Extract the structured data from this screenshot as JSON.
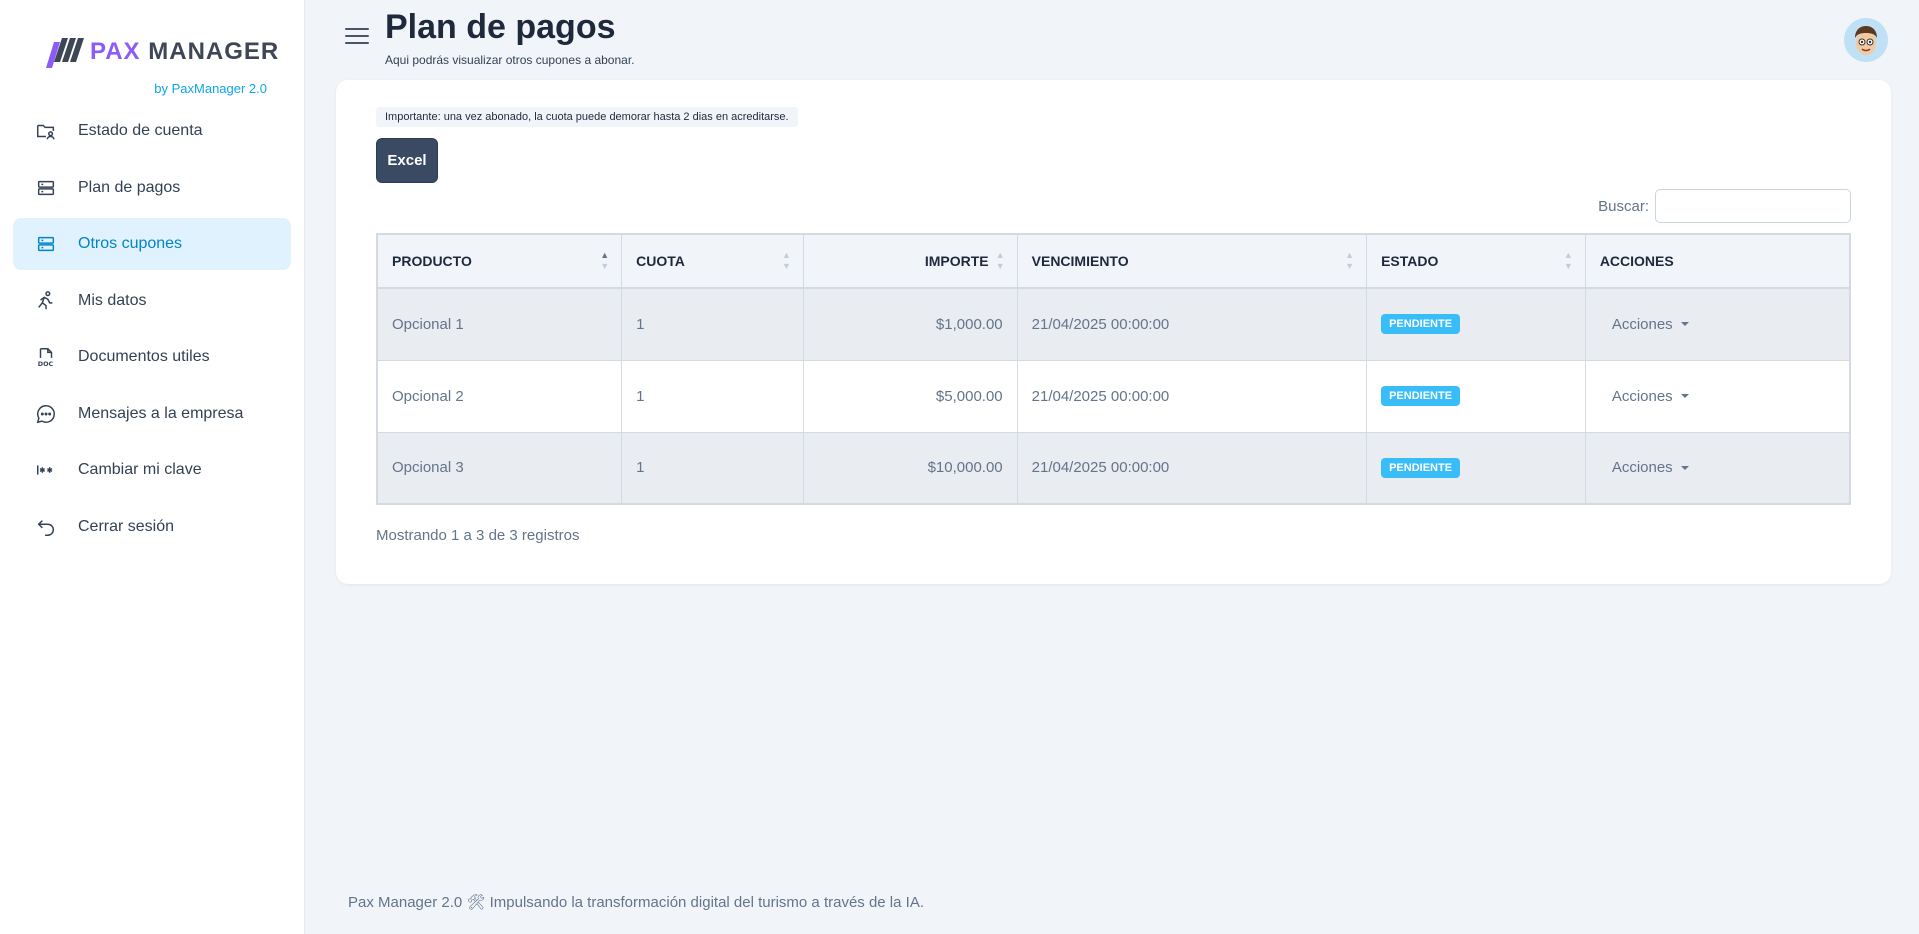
{
  "brand": {
    "pax": "PAX",
    "manager": "MANAGER",
    "sub": "by PaxManager 2.0"
  },
  "sidebar": {
    "items": [
      {
        "label": "Estado de cuenta",
        "icon": "folder-user-icon",
        "active": false
      },
      {
        "label": "Plan de pagos",
        "icon": "server-stack-icon",
        "active": false
      },
      {
        "label": "Otros cupones",
        "icon": "server-stack-icon",
        "active": true
      },
      {
        "label": "Mis datos",
        "icon": "running-person-icon",
        "active": false
      },
      {
        "label": "Documentos utiles",
        "icon": "doc-file-icon",
        "active": false
      },
      {
        "label": "Mensajes a la empresa",
        "icon": "chat-bubble-icon",
        "active": false
      },
      {
        "label": "Cambiar mi clave",
        "icon": "password-icon",
        "active": false
      },
      {
        "label": "Cerrar sesión",
        "icon": "back-arrow-icon",
        "active": false
      }
    ]
  },
  "header": {
    "title": "Plan de pagos",
    "subtitle": "Aqui podrás visualizar otros cupones a abonar."
  },
  "notice": "Importante: una vez abonado, la cuota puede demorar hasta 2 dias en acreditarse.",
  "excel_label": "Excel",
  "search": {
    "label": "Buscar:",
    "value": "",
    "placeholder": ""
  },
  "table": {
    "headers": [
      "PRODUCTO",
      "CUOTA",
      "IMPORTE",
      "VENCIMIENTO",
      "ESTADO",
      "ACCIONES"
    ],
    "rows": [
      {
        "producto": "Opcional 1",
        "cuota": "1",
        "importe": "$1,000.00",
        "vencimiento": "21/04/2025 00:00:00",
        "estado": "PENDIENTE",
        "acciones": "Acciones"
      },
      {
        "producto": "Opcional 2",
        "cuota": "1",
        "importe": "$5,000.00",
        "vencimiento": "21/04/2025 00:00:00",
        "estado": "PENDIENTE",
        "acciones": "Acciones"
      },
      {
        "producto": "Opcional 3",
        "cuota": "1",
        "importe": "$10,000.00",
        "vencimiento": "21/04/2025 00:00:00",
        "estado": "PENDIENTE",
        "acciones": "Acciones"
      }
    ]
  },
  "info": "Mostrando 1 a 3 de 3 registros",
  "footer": "Pax Manager 2.0 🛠 Impulsando la transformación digital del turismo a través de la IA.",
  "colors": {
    "accent": "#0ea5e9",
    "brand_purple": "#8b5cf6",
    "badge": "#38bdf8",
    "button": "#3a4a63"
  }
}
